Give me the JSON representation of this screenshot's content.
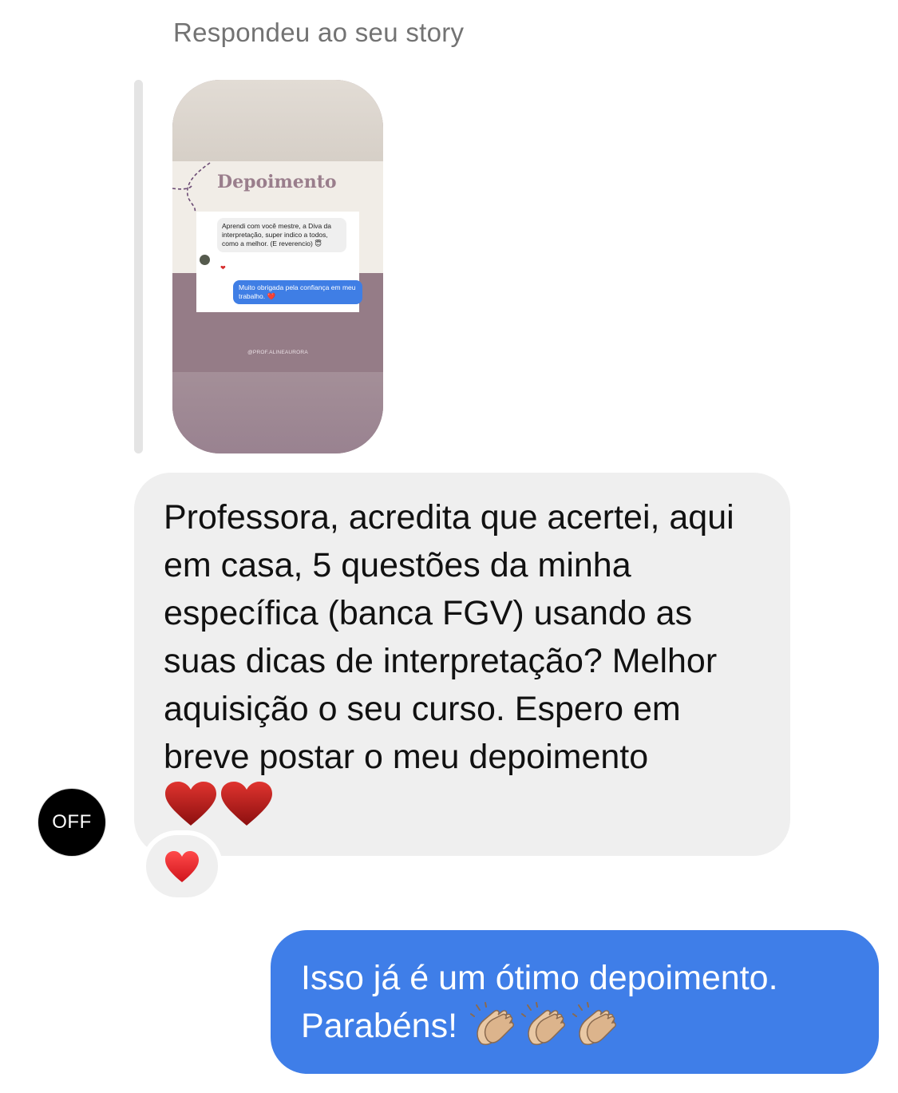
{
  "story_reply": {
    "caption": "Respondeu ao seu story"
  },
  "story_preview": {
    "title": "Depoimento",
    "incoming_text": "Aprendi com você mestre, a Diva da interpretação,  super indico a todos, como a melhor. (E reverencio) 😇",
    "outgoing_text": "Muito obrigada pela confiança em meu trabalho. ❤️",
    "handle": "@PROF.ALINEAURORA",
    "heart_icon": "heart-icon"
  },
  "contact": {
    "avatar_text": "OFF"
  },
  "messages": {
    "incoming": {
      "text": "Professora, acredita que acertei, aqui em casa, 5 questões da minha específica (banca FGV) usando as suas dicas de interpretação? Melhor aquisição o seu curso. Espero em breve postar o meu depoimento",
      "trailing_emoji": "❤️❤️",
      "reaction": "❤️"
    },
    "outgoing": {
      "text": "Isso já é um ótimo depoimento. Parabéns!",
      "trailing_icons": [
        "clapping-hands-icon",
        "clapping-hands-icon",
        "clapping-hands-icon"
      ]
    }
  },
  "colors": {
    "incoming_bubble": "#efefef",
    "outgoing_bubble": "#3f7ee8",
    "heart": "#c21a1a",
    "caption_gray": "#737373"
  }
}
